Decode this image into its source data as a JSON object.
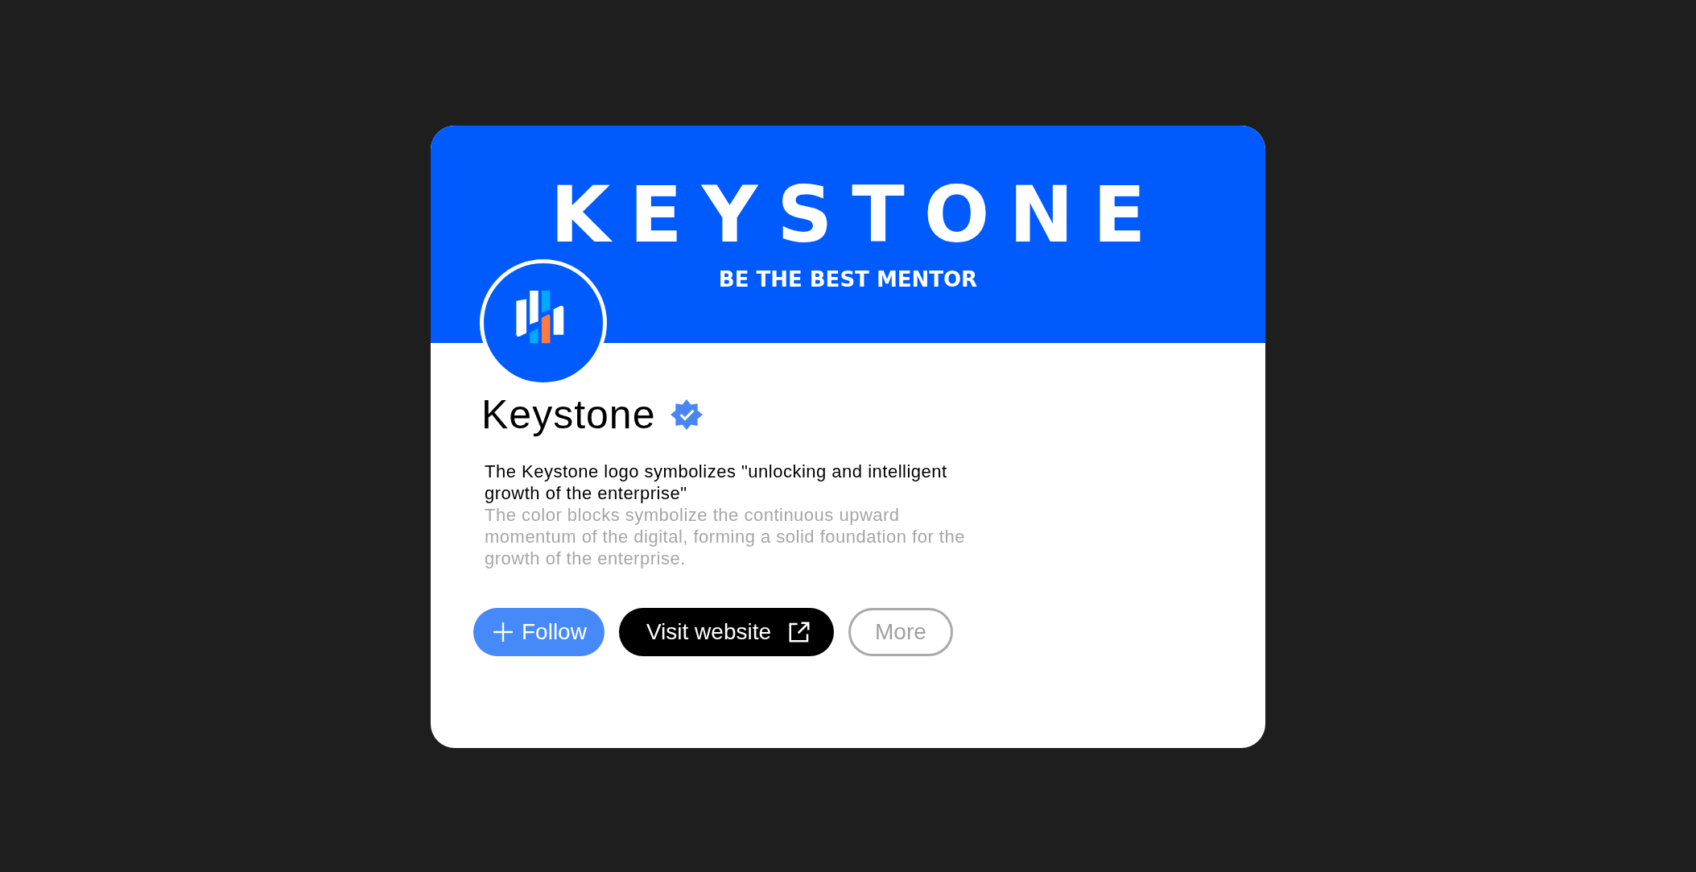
{
  "banner": {
    "wordmark": "KEYSTONE",
    "tagline": "BE THE BEST MENTOR"
  },
  "profile": {
    "name": "Keystone",
    "verified": true,
    "description": "The Keystone logo symbolizes \"unlocking and intelligent growth of the enterprise\"",
    "details": "The color blocks symbolize the continuous upward momentum of the digital, forming a solid foundation for the growth of the enterprise."
  },
  "buttons": [
    {
      "kind": "follow",
      "label": "Follow"
    },
    {
      "kind": "link",
      "label": "Visit website"
    },
    {
      "kind": "outline",
      "label": "More"
    }
  ]
}
